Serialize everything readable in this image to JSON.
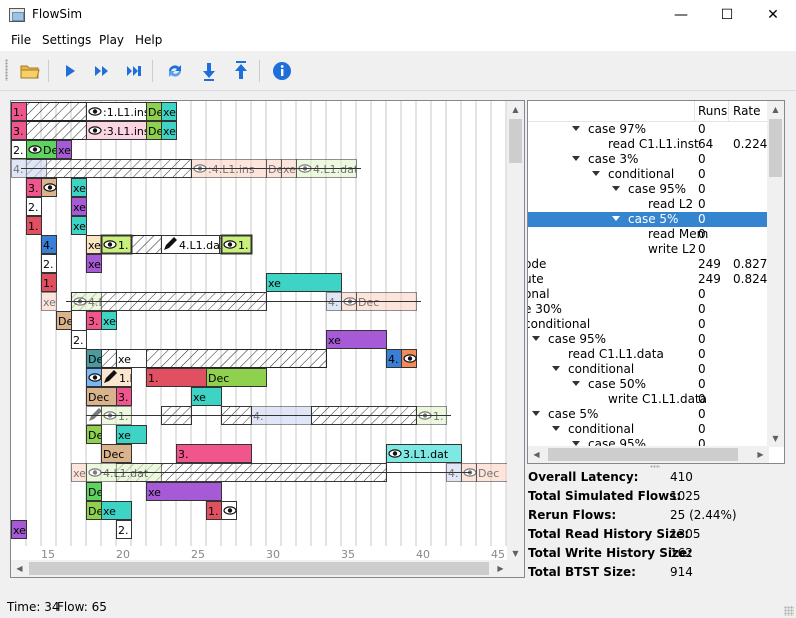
{
  "window": {
    "title": "FlowSim",
    "minimize_glyph": "—",
    "maximize_glyph": "☐",
    "close_glyph": "✕"
  },
  "menubar": {
    "file": "File",
    "settings": "Settings",
    "play": "Play",
    "help": "Help"
  },
  "toolbar": {
    "items": [
      "open-folder-icon",
      "play-icon",
      "fast-forward-icon",
      "skip-to-end-icon",
      "refresh-icon",
      "step-down-icon",
      "step-up-icon",
      "info-icon"
    ]
  },
  "colors": {
    "selection": "#3584d0",
    "accent_blue": "#1e6fd9",
    "info_blue": "#1e6fd9"
  },
  "timeline": {
    "axis_ticks": [
      "15",
      "20",
      "25",
      "30",
      "35",
      "40",
      "45"
    ],
    "blocks": [
      {
        "row": 0,
        "text": "1.",
        "bg": "#f0568c"
      },
      {
        "row": 0,
        "text": ":1.L1.ins",
        "bg": "#ffffff",
        "icon": "eye-icon"
      },
      {
        "row": 0,
        "text": "Dec",
        "bg": "#8fd14f"
      },
      {
        "row": 0,
        "text": "xe",
        "bg": "#3dd4c6"
      },
      {
        "row": 1,
        "text": "3.",
        "bg": "#f0568c"
      },
      {
        "row": 1,
        "text": ":3.L1.ins",
        "bg": "#fbd5e3",
        "icon": "eye-icon"
      },
      {
        "row": 1,
        "text": "Dec",
        "bg": "#8fd14f"
      },
      {
        "row": 1,
        "text": "xe",
        "bg": "#3dd4c6"
      },
      {
        "row": 2,
        "text": "2.",
        "bg": "#ffffff"
      },
      {
        "row": 2,
        "text": "Dec",
        "bg": "#5fd35f",
        "icon": "eye-icon"
      },
      {
        "row": 2,
        "text": "xe",
        "bg": "#a65ad6"
      },
      {
        "row": 3,
        "text": "4.",
        "bg": "#c9d3f0"
      },
      {
        "row": 3,
        "text": ":4.L1.ins",
        "bg": "#fcd1c1",
        "icon": "eye-icon"
      },
      {
        "row": 3,
        "text": "Dec",
        "bg": "#fcd1c1"
      },
      {
        "row": 3,
        "text": "xe",
        "bg": "#fcd1c1"
      },
      {
        "row": 3,
        "text": "4.L1.dat",
        "bg": "#e0f5c5",
        "icon": "eye-icon"
      },
      {
        "row": 4,
        "text": "3.",
        "bg": "#f0568c"
      },
      {
        "row": 4,
        "text": "Dec",
        "bg": "#d9b38c",
        "icon": "eye-icon"
      },
      {
        "row": 4,
        "text": "xe",
        "bg": "#3dd4c6"
      },
      {
        "row": 5,
        "text": "2.",
        "bg": "#ffffff"
      },
      {
        "row": 5,
        "text": "xe",
        "bg": "#a65ad6"
      },
      {
        "row": 6,
        "text": "1.",
        "bg": "#e05060"
      },
      {
        "row": 6,
        "text": "xe",
        "bg": "#3dd4c6"
      },
      {
        "row": 7,
        "text": "4.",
        "bg": "#3a7fd6"
      },
      {
        "row": 7,
        "text": "xe",
        "bg": "#fbe4c0"
      },
      {
        "row": 7,
        "text": "1.",
        "bg": "#c8f07a",
        "icon": "eye-icon"
      },
      {
        "row": 7,
        "text": "4.L1.dat",
        "bg": "#ffffff",
        "icon": "pencil-icon"
      },
      {
        "row": 7,
        "text": "1.",
        "bg": "#c8f07a",
        "icon": "eye-icon"
      },
      {
        "row": 8,
        "text": "2.",
        "bg": "#ffffff"
      },
      {
        "row": 8,
        "text": "xe",
        "bg": "#a65ad6"
      },
      {
        "row": 9,
        "text": "1.",
        "bg": "#e05060"
      },
      {
        "row": 9,
        "text": "xe",
        "bg": "#3dd4c6"
      },
      {
        "row": 10,
        "text": "4.",
        "bg": "#c9d3f0"
      },
      {
        "row": 10,
        "text": ":4.L1.ins",
        "bg": "#fcd1c1",
        "icon": "eye-icon"
      },
      {
        "row": 10,
        "text": "Dec",
        "bg": "#fcd1c1"
      },
      {
        "row": 10,
        "text": "xe",
        "bg": "#fcd1c1"
      },
      {
        "row": 10,
        "text": "4.L1.dat",
        "bg": "#e0f5c5",
        "icon": "eye-icon"
      },
      {
        "row": 11,
        "text": "3.",
        "bg": "#f0568c"
      },
      {
        "row": 11,
        "text": "Dec",
        "bg": "#d9b38c"
      },
      {
        "row": 11,
        "text": "xe",
        "bg": "#3dd4c6"
      },
      {
        "row": 12,
        "text": "2.",
        "bg": "#ffffff"
      },
      {
        "row": 12,
        "text": "xe",
        "bg": "#a65ad6"
      },
      {
        "row": 13,
        "text": "4.",
        "bg": "#3a7fd6"
      },
      {
        "row": 13,
        "text": ":4.L1.ins",
        "bg": "#f28a5a",
        "icon": "eye-icon"
      },
      {
        "row": 13,
        "text": "Dec",
        "bg": "#4a9aa0"
      },
      {
        "row": 13,
        "text": "xe",
        "bg": "#ffffff"
      },
      {
        "row": 14,
        "text": "1.",
        "bg": "#e05060"
      },
      {
        "row": 14,
        "text": "Dec",
        "bg": "#8fd14f"
      },
      {
        "row": 14,
        "text": "1.L1.dat",
        "bg": "#7ab8f5",
        "icon": "eye-icon"
      },
      {
        "row": 14,
        "text": "1.L1.dat",
        "bg": "#fde6cf",
        "icon": "pencil-icon"
      },
      {
        "row": 15,
        "text": "3.",
        "bg": "#f0568c"
      },
      {
        "row": 15,
        "text": "Dec",
        "bg": "#d9b38c"
      },
      {
        "row": 15,
        "text": "xe",
        "bg": "#3dd4c6"
      },
      {
        "row": 16,
        "text": "4.",
        "bg": "#c9d3f0"
      },
      {
        "row": 16,
        "text": "1.",
        "bg": "#e0f5c5",
        "icon": "eye-icon"
      },
      {
        "row": 16,
        "text": "4.L1.dat",
        "bg": "#ffffff",
        "icon": "pencil-icon"
      },
      {
        "row": 16,
        "text": "1.",
        "bg": "#e0f5c5",
        "icon": "eye-icon"
      },
      {
        "row": 17,
        "text": "1.",
        "bg": "#e05060"
      },
      {
        "row": 17,
        "text": "Dec",
        "bg": "#8fd14f"
      },
      {
        "row": 17,
        "text": "xe",
        "bg": "#3dd4c6"
      },
      {
        "row": 18,
        "text": "3.",
        "bg": "#f0568c"
      },
      {
        "row": 18,
        "text": "Dec",
        "bg": "#d9b38c"
      },
      {
        "row": 18,
        "text": "3.L1.dat",
        "bg": "#7ee8e2",
        "icon": "eye-icon"
      },
      {
        "row": 19,
        "text": "4.",
        "bg": "#c9d3f0"
      },
      {
        "row": 19,
        "text": ":4.L1.ins",
        "bg": "#fcd1c1",
        "icon": "eye-icon"
      },
      {
        "row": 19,
        "text": "Dec",
        "bg": "#fcd1c1"
      },
      {
        "row": 19,
        "text": "xe",
        "bg": "#fcd1c1"
      },
      {
        "row": 19,
        "text": "4.L1.dat",
        "bg": "#e0f5c5",
        "icon": "eye-icon"
      },
      {
        "row": 20,
        "text": "2.",
        "bg": "#ffffff"
      },
      {
        "row": 20,
        "text": ":2.L1.ins",
        "bg": "#ffffff",
        "icon": "eye-icon"
      },
      {
        "row": 20,
        "text": "Dec",
        "bg": "#5fd35f"
      },
      {
        "row": 20,
        "text": "xe",
        "bg": "#a65ad6"
      },
      {
        "row": 21,
        "text": "1.",
        "bg": "#e05060"
      },
      {
        "row": 21,
        "text": ":1.L1.ins",
        "bg": "#ffffff",
        "icon": "eye-icon"
      },
      {
        "row": 21,
        "text": "Dec",
        "bg": "#8fd14f"
      },
      {
        "row": 21,
        "text": "xe",
        "bg": "#3dd4c6"
      },
      {
        "row": 22,
        "text": "2.",
        "bg": "#ffffff"
      },
      {
        "row": 22,
        "text": "Dec",
        "bg": "#5fd35f"
      },
      {
        "row": 22,
        "text": "xe",
        "bg": "#a65ad6"
      }
    ]
  },
  "tree": {
    "columns": {
      "name": "",
      "runs": "Runs",
      "rate": "Rate"
    },
    "rows": [
      {
        "label": "case 97%",
        "runs": "0",
        "rate": "",
        "level": 2,
        "expanded": true
      },
      {
        "label": "read C1.L1.inst",
        "runs": "64",
        "rate": "0.224",
        "level": 3,
        "expanded": null
      },
      {
        "label": "case 3%",
        "runs": "0",
        "rate": "",
        "level": 2,
        "expanded": true
      },
      {
        "label": "conditional",
        "runs": "0",
        "rate": "",
        "level": 3,
        "expanded": true
      },
      {
        "label": "case 95%",
        "runs": "0",
        "rate": "",
        "level": 4,
        "expanded": true
      },
      {
        "label": "read L2",
        "runs": "0",
        "rate": "",
        "level": 5,
        "expanded": null
      },
      {
        "label": "case 5%",
        "runs": "0",
        "rate": "",
        "level": 4,
        "expanded": true,
        "selected": true
      },
      {
        "label": "read Mem",
        "runs": "0",
        "rate": "",
        "level": 5,
        "expanded": null
      },
      {
        "label": "write L2",
        "runs": "0",
        "rate": "",
        "level": 5,
        "expanded": null
      },
      {
        "label": "ode",
        "runs": "249",
        "rate": "0.827",
        "level": -1,
        "expanded": null
      },
      {
        "label": "ute",
        "runs": "249",
        "rate": "0.824",
        "level": -1,
        "expanded": null
      },
      {
        "label": "onal",
        "runs": "0",
        "rate": "",
        "level": -1,
        "expanded": null
      },
      {
        "label": "e 30%",
        "runs": "0",
        "rate": "",
        "level": -1,
        "expanded": null
      },
      {
        "label": "conditional",
        "runs": "0",
        "rate": "",
        "level": -1,
        "expanded": null
      },
      {
        "label": "case 95%",
        "runs": "0",
        "rate": "",
        "level": 0,
        "expanded": true
      },
      {
        "label": "read C1.L1.data",
        "runs": "0",
        "rate": "",
        "level": 1,
        "expanded": null
      },
      {
        "label": "conditional",
        "runs": "0",
        "rate": "",
        "level": 1,
        "expanded": true
      },
      {
        "label": "case 50%",
        "runs": "0",
        "rate": "",
        "level": 2,
        "expanded": true
      },
      {
        "label": "write C1.L1.data",
        "runs": "0",
        "rate": "",
        "level": 3,
        "expanded": null
      },
      {
        "label": "case 5%",
        "runs": "0",
        "rate": "",
        "level": 0,
        "expanded": true
      },
      {
        "label": "conditional",
        "runs": "0",
        "rate": "",
        "level": 1,
        "expanded": true
      },
      {
        "label": "case 95%",
        "runs": "0",
        "rate": "",
        "level": 2,
        "expanded": true
      }
    ]
  },
  "stats": [
    {
      "label": "Overall Latency:",
      "value": "410"
    },
    {
      "label": "Total Simulated Flows:",
      "value": "1025"
    },
    {
      "label": "Rerun Flows:",
      "value": "25 (2.44%)"
    },
    {
      "label": "Total Read History Size:",
      "value": "1305"
    },
    {
      "label": "Total Write History Size:",
      "value": "162"
    },
    {
      "label": "Total BTST Size:",
      "value": "914"
    }
  ],
  "status": {
    "time": "Time: 34",
    "flow": "Flow: 65"
  }
}
